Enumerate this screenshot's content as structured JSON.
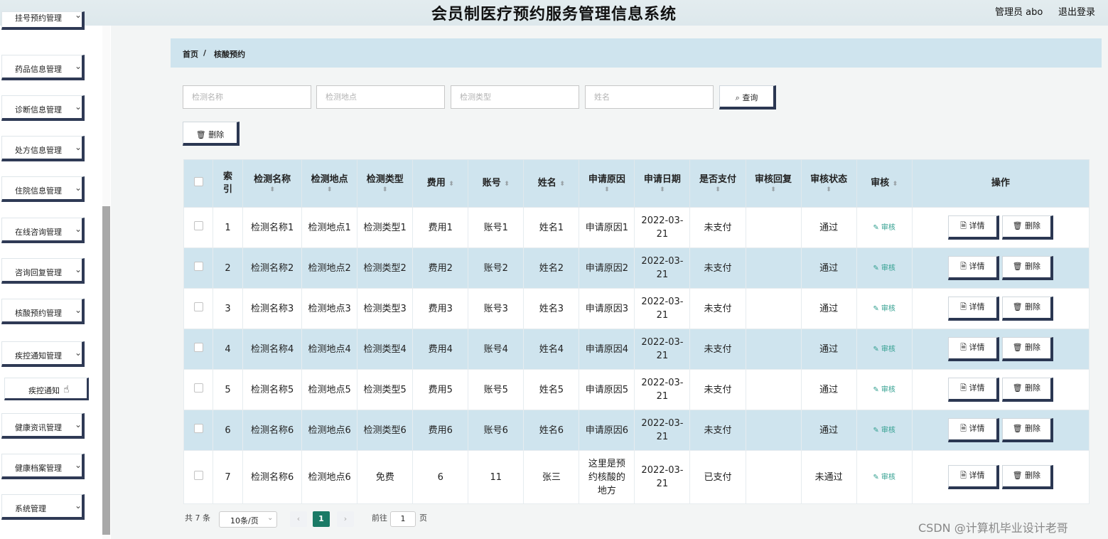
{
  "header": {
    "title": "会员制医疗预约服务管理信息系统",
    "admin": "管理员 abo",
    "logout": "退出登录"
  },
  "sidebar": {
    "items": [
      {
        "label": "挂号预约管理"
      },
      {
        "label": "药品信息管理"
      },
      {
        "label": "诊断信息管理"
      },
      {
        "label": "处方信息管理"
      },
      {
        "label": "住院信息管理"
      },
      {
        "label": "在线咨询管理"
      },
      {
        "label": "咨询回复管理"
      },
      {
        "label": "核酸预约管理"
      },
      {
        "label": "疾控通知管理"
      },
      {
        "label": "健康资讯管理"
      },
      {
        "label": "健康档案管理"
      },
      {
        "label": "系统管理"
      }
    ],
    "submenu_label": "疾控通知",
    "chevron": "chevron-down-icon"
  },
  "breadcrumb": {
    "home": "首页",
    "sep": "/",
    "current": "核酸预约"
  },
  "search": {
    "name_placeholder": "检测名称",
    "place_placeholder": "检测地点",
    "type_placeholder": "检测类型",
    "person_placeholder": "姓名",
    "query_label": "查询"
  },
  "toolbar": {
    "delete_label": "删除"
  },
  "table": {
    "headers": {
      "index": "索引",
      "name": "检测名称",
      "place": "检测地点",
      "type": "检测类型",
      "fee": "费用",
      "account": "账号",
      "person": "姓名",
      "reason": "申请原因",
      "date": "申请日期",
      "paid": "是否支付",
      "reply": "审核回复",
      "status": "审核状态",
      "audit": "审核",
      "ops": "操作"
    },
    "audit_label": "审核",
    "detail_label": "详情",
    "delete_label": "删除",
    "rows": [
      {
        "idx": "1",
        "name": "检测名称1",
        "place": "检测地点1",
        "type": "检测类型1",
        "fee": "费用1",
        "account": "账号1",
        "person": "姓名1",
        "reason": "申请原因1",
        "date": "2022-03-21",
        "paid": "未支付",
        "reply": "",
        "status": "通过"
      },
      {
        "idx": "2",
        "name": "检测名称2",
        "place": "检测地点2",
        "type": "检测类型2",
        "fee": "费用2",
        "account": "账号2",
        "person": "姓名2",
        "reason": "申请原因2",
        "date": "2022-03-21",
        "paid": "未支付",
        "reply": "",
        "status": "通过"
      },
      {
        "idx": "3",
        "name": "检测名称3",
        "place": "检测地点3",
        "type": "检测类型3",
        "fee": "费用3",
        "account": "账号3",
        "person": "姓名3",
        "reason": "申请原因3",
        "date": "2022-03-21",
        "paid": "未支付",
        "reply": "",
        "status": "通过"
      },
      {
        "idx": "4",
        "name": "检测名称4",
        "place": "检测地点4",
        "type": "检测类型4",
        "fee": "费用4",
        "account": "账号4",
        "person": "姓名4",
        "reason": "申请原因4",
        "date": "2022-03-21",
        "paid": "未支付",
        "reply": "",
        "status": "通过"
      },
      {
        "idx": "5",
        "name": "检测名称5",
        "place": "检测地点5",
        "type": "检测类型5",
        "fee": "费用5",
        "account": "账号5",
        "person": "姓名5",
        "reason": "申请原因5",
        "date": "2022-03-21",
        "paid": "未支付",
        "reply": "",
        "status": "通过"
      },
      {
        "idx": "6",
        "name": "检测名称6",
        "place": "检测地点6",
        "type": "检测类型6",
        "fee": "费用6",
        "account": "账号6",
        "person": "姓名6",
        "reason": "申请原因6",
        "date": "2022-03-21",
        "paid": "未支付",
        "reply": "",
        "status": "通过"
      },
      {
        "idx": "7",
        "name": "检测名称6",
        "place": "检测地点6",
        "type": "免费",
        "fee": "6",
        "account": "11",
        "person": "张三",
        "reason": "这里是预约核酸的地方",
        "date": "2022-03-21",
        "paid": "已支付",
        "reply": "",
        "status": "未通过"
      }
    ]
  },
  "pagination": {
    "total": "共 7 条",
    "page_size": "10条/页",
    "current_page": "1",
    "goto_label": "前往",
    "goto_value": "1",
    "page_suffix": "页"
  },
  "watermark": "CSDN @计算机毕业设计老哥",
  "colors": {
    "accent": "#2b3752",
    "highlight_row": "#cfe4ee",
    "page_active": "#1a7a66"
  }
}
